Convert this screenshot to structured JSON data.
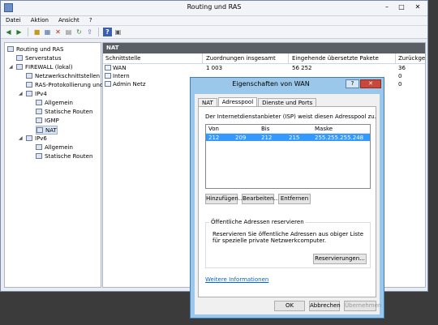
{
  "app": {
    "title": "Routing und RAS"
  },
  "menu": [
    "Datei",
    "Aktion",
    "Ansicht",
    "?"
  ],
  "window_buttons": {
    "minimize": "–",
    "maximize": "□",
    "close": "✕"
  },
  "tree": {
    "root": "Routing und RAS",
    "items": [
      {
        "label": "Serverstatus",
        "level": 1
      },
      {
        "label": "FIREWALL (lokal)",
        "level": 1
      },
      {
        "label": "Netzwerkschnittstellen",
        "level": 2
      },
      {
        "label": "RAS-Protokollierung und",
        "level": 2
      },
      {
        "label": "IPv4",
        "level": 2
      },
      {
        "label": "Allgemein",
        "level": 3
      },
      {
        "label": "Statische Routen",
        "level": 3
      },
      {
        "label": "IGMP",
        "level": 3
      },
      {
        "label": "NAT",
        "level": 3
      },
      {
        "label": "IPv6",
        "level": 2
      },
      {
        "label": "Allgemein",
        "level": 3
      },
      {
        "label": "Statische Routen",
        "level": 3
      }
    ]
  },
  "nat_panel": {
    "header": "NAT",
    "columns": [
      "Schnittstelle",
      "Zuordnungen insgesamt",
      "Eingehende übersetzte Pakete",
      "Zurückgew"
    ],
    "rows": [
      [
        "WAN",
        "1 003",
        "56 252",
        "36"
      ],
      [
        "Intern",
        "",
        "",
        "0"
      ],
      [
        "Admin Netz",
        "",
        "",
        "0"
      ]
    ]
  },
  "dialog": {
    "title": "Eigenschaften von WAN",
    "help": "?",
    "close": "✕",
    "tabs": [
      "NAT",
      "Adresspool",
      "Dienste und Ports"
    ],
    "description": "Der Internetdienstanbieter (ISP) weist diesen Adresspool zu.",
    "list_columns": [
      "Von",
      "Bis",
      "Maske"
    ],
    "list_row": {
      "von_a": "212",
      "von_b": "209",
      "bis_a": "212",
      "bis_b": "215",
      "maske": "255.255.255.248"
    },
    "buttons": {
      "add": "Hinzufügen...",
      "edit": "Bearbeiten...",
      "remove": "Entfernen"
    },
    "group": {
      "title": "Öffentliche Adressen reservieren",
      "text": "Reservieren Sie öffentliche Adressen aus obiger Liste für spezielle private Netzwerkcomputer.",
      "button": "Reservierungen..."
    },
    "link": "Weitere Informationen",
    "footer": {
      "ok": "OK",
      "cancel": "Abbrechen",
      "apply": "Übernehmen"
    }
  }
}
